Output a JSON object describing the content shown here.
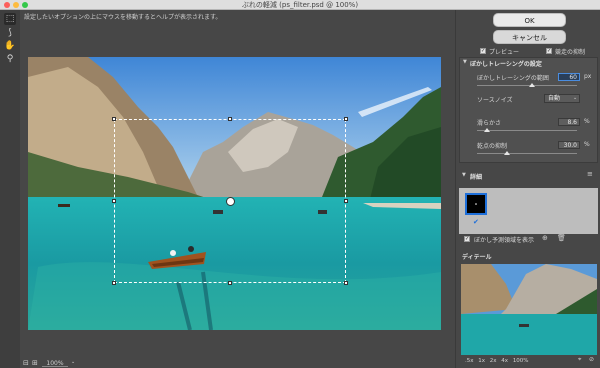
{
  "window": {
    "title": "ぶれの軽減 (ps_filter.psd @ 100%)"
  },
  "hint": "設定したいオプションの上にマウスを移動するとヘルプが表示されます。",
  "status": {
    "zoom": "100%"
  },
  "buttons": {
    "ok": "OK",
    "cancel": "キャンセル"
  },
  "checks": {
    "preview": "プレビュー",
    "artifact": "競走の抑制"
  },
  "settings": {
    "title": "ぼかしトレーシングの設定",
    "bounds_label": "ぼかしトレーシングの範囲",
    "bounds_value": "60",
    "bounds_unit": "px",
    "noise_label": "ソースノイズ",
    "noise_value": "自動",
    "smooth_label": "滑らかさ",
    "smooth_value": "8.6",
    "smooth_unit": "%",
    "artifact_label": "乾点の抑制",
    "artifact_value": "30.0",
    "artifact_unit": "%",
    "smooth_level": 0.1,
    "artifact_level": 0.3,
    "bounds_level": 0.55
  },
  "detail_section": {
    "title": "詳細",
    "show_trace": "ぼかし予測領域を表示"
  },
  "loupe": {
    "title": "ディテール"
  },
  "zoom_levels": {
    "a": ".5x",
    "b": "1x",
    "c": "2x",
    "d": "4x",
    "e": "100%"
  }
}
